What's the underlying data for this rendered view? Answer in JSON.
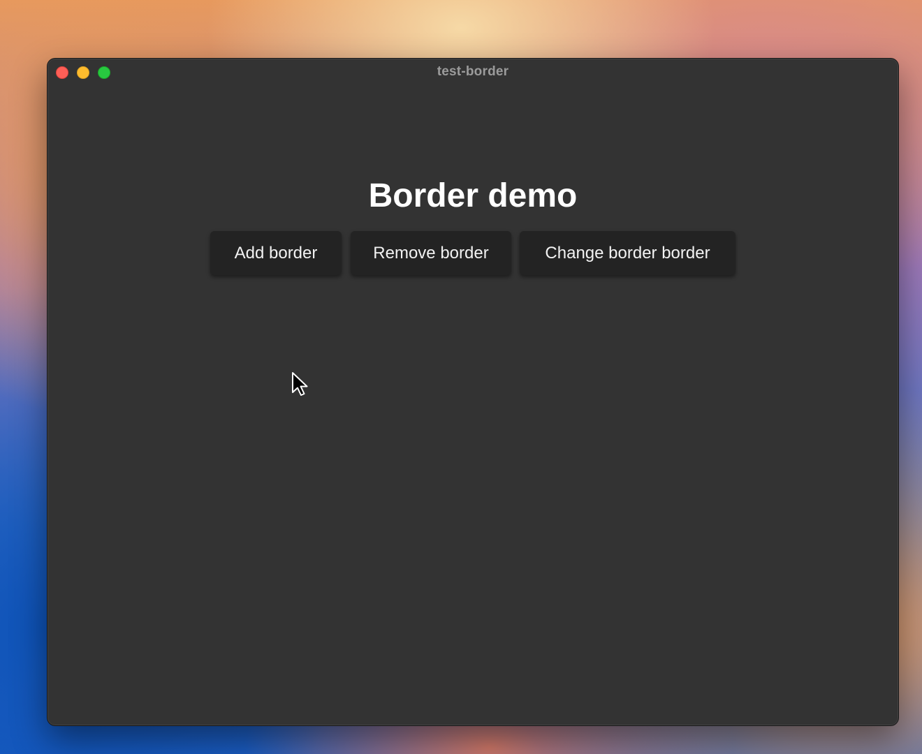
{
  "window": {
    "title": "test-border"
  },
  "main": {
    "heading": "Border demo",
    "buttons": {
      "add": "Add border",
      "remove": "Remove border",
      "change": "Change border border"
    }
  },
  "colors": {
    "window_background": "#333333",
    "button_background": "#232323",
    "close": "#fe5f57",
    "minimize": "#febc2e",
    "maximize": "#28c840"
  },
  "icons": {
    "cursor": "mouse-pointer-icon"
  }
}
